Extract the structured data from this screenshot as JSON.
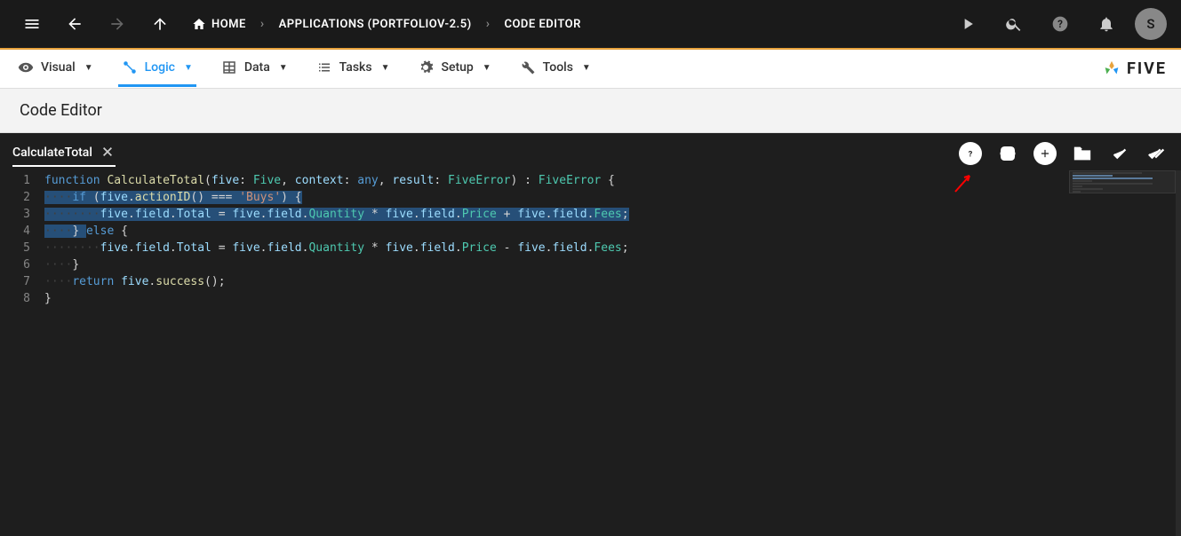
{
  "topbar": {
    "home_label": "HOME",
    "breadcrumb_app": "APPLICATIONS (PORTFOLIOV-2.5)",
    "breadcrumb_page": "CODE EDITOR",
    "avatar_letter": "S"
  },
  "subnav": {
    "items": [
      {
        "label": "Visual"
      },
      {
        "label": "Logic"
      },
      {
        "label": "Data"
      },
      {
        "label": "Tasks"
      },
      {
        "label": "Setup"
      },
      {
        "label": "Tools"
      }
    ],
    "logo_text": "FIVE"
  },
  "page": {
    "title": "Code Editor"
  },
  "editor": {
    "tab_name": "CalculateTotal",
    "line_numbers": [
      "1",
      "2",
      "3",
      "4",
      "5",
      "6",
      "7",
      "8"
    ],
    "code": {
      "l1": {
        "kw_function": "function",
        "fn_name": " CalculateTotal",
        "p_open": "(",
        "param1": "five",
        "colon1": ": ",
        "type1": "Five",
        "comma1": ", ",
        "param2": "context",
        "colon2": ": ",
        "type2": "any",
        "comma2": ", ",
        "param3": "result",
        "colon3": ": ",
        "type3": "FiveError",
        "p_close": ") : ",
        "ret": "FiveError",
        "brace": " {"
      },
      "l2": {
        "indent": "····",
        "kw_if": "if",
        "cond_open": " (",
        "obj": "five",
        "dot": ".",
        "method": "actionID",
        "call": "() === ",
        "str": "'Buys'",
        "cond_close": ") {"
      },
      "l3": {
        "indent": "········",
        "obj1": "five",
        "d1": ".",
        "p1": "field",
        "d2": ".",
        "p2": "Total",
        "eq": " = ",
        "obj2": "five",
        "d3": ".",
        "p3": "field",
        "d4": ".",
        "p4": "Quantity",
        "op1": " * ",
        "obj3": "five",
        "d5": ".",
        "p5": "field",
        "d6": ".",
        "p6": "Price",
        "op2": " + ",
        "obj4": "five",
        "d7": ".",
        "p7": "field",
        "d8": ".",
        "p8": "Fees",
        "semi": ";"
      },
      "l4": {
        "indent": "····",
        "close": "} ",
        "kw_else": "else",
        "brace": " {"
      },
      "l5": {
        "indent": "········",
        "obj1": "five",
        "d1": ".",
        "p1": "field",
        "d2": ".",
        "p2": "Total",
        "eq": " = ",
        "obj2": "five",
        "d3": ".",
        "p3": "field",
        "d4": ".",
        "p4": "Quantity",
        "op1": " * ",
        "obj3": "five",
        "d5": ".",
        "p5": "field",
        "d6": ".",
        "p6": "Price",
        "op2": " - ",
        "obj4": "five",
        "d7": ".",
        "p7": "field",
        "d8": ".",
        "p8": "Fees",
        "semi": ";"
      },
      "l6": {
        "indent": "····",
        "close": "}"
      },
      "l7": {
        "indent": "····",
        "kw_return": "return",
        "sp": " ",
        "obj": "five",
        "d": ".",
        "method": "success",
        "call": "();"
      },
      "l8": {
        "close": "}"
      }
    }
  }
}
